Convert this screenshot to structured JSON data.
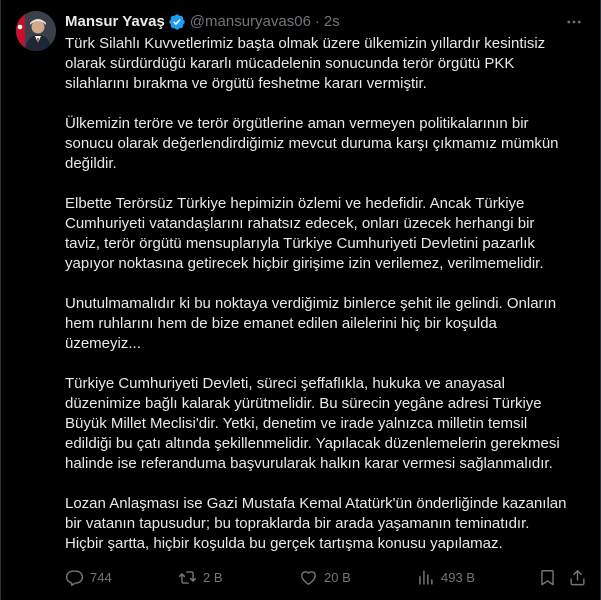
{
  "tweet": {
    "author": {
      "display_name": "Mansur Yavaş",
      "handle": "@mansuryavas06",
      "verified": true,
      "verified_badge_icon": "verified-badge-icon",
      "avatar_icon": "avatar"
    },
    "separator": "·",
    "timestamp": "2s",
    "more_icon": "more-options-icon",
    "paragraphs": [
      "Türk Silahlı Kuvvetlerimiz başta olmak üzere ülkemizin yıllardır kesintisiz\nolarak sürdürdüğü kararlı mücadelenin sonucunda terör örgütü PKK\nsilahlarını bırakma ve örgütü feshetme kararı vermiştir.",
      "Ülkemizin teröre ve terör örgütlerine aman vermeyen politikalarının bir\nsonucu olarak değerlendirdiğimiz mevcut duruma karşı çıkmamız mümkün\ndeğildir.",
      "Elbette Terörsüz Türkiye hepimizin özlemi ve hedefidir. Ancak Türkiye\nCumhuriyeti vatandaşlarını rahatsız edecek, onları üzecek herhangi bir\ntaviz, terör örgütü mensuplarıyla Türkiye Cumhuriyeti Devletini pazarlık\nyapıyor noktasına getirecek hiçbir girişime izin verilemez, verilmemelidir.",
      "Unutulmamalıdır ki bu noktaya verdiğimiz binlerce şehit ile gelindi. Onların\nhem ruhlarını hem de bize emanet edilen ailelerini hiç bir koşulda\nüzemeyiz...",
      "Türkiye Cumhuriyeti Devleti, süreci şeffaflıkla, hukuka ve anayasal\ndüzenimize bağlı kalarak yürütmelidir. Bu sürecin yegâne adresi Türkiye\nBüyük Millet Meclisi'dir. Yetki, denetim ve irade yalnızca milletin temsil\nedildiği bu çatı altında şekillenmelidir. Yapılacak düzenlemelerin gerekmesi\nhalinde ise referanduma başvurularak halkın karar vermesi sağlanmalıdır.",
      "Lozan Anlaşması ise Gazi Mustafa Kemal Atatürk'ün önderliğinde kazanılan\nbir vatanın tapusudur; bu topraklarda bir arada yaşamanın teminatıdır.\nHiçbir şartta, hiçbir koşulda bu gerçek tartışma konusu yapılamaz."
    ],
    "actions": {
      "reply": {
        "icon": "reply-icon",
        "count": "744"
      },
      "retweet": {
        "icon": "retweet-icon",
        "count": "2 B"
      },
      "like": {
        "icon": "like-icon",
        "count": "20 B"
      },
      "views": {
        "icon": "views-icon",
        "count": "493 B"
      },
      "bookmark": {
        "icon": "bookmark-icon"
      },
      "share": {
        "icon": "share-icon"
      }
    }
  },
  "colors": {
    "background": "#000000",
    "text_primary": "#e7e9ea",
    "text_secondary": "#71767b",
    "verified_blue": "#1d9bf0",
    "border": "#2f3336"
  }
}
